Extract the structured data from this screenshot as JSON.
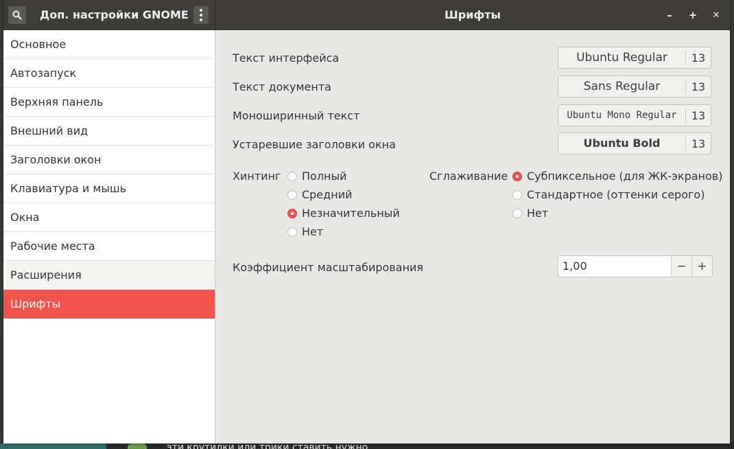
{
  "titlebar": {
    "app_title": "Доп. настройки GNOME",
    "page_title": "Шрифты",
    "minimize_glyph": "–",
    "maximize_glyph": "+",
    "close_glyph": "✕"
  },
  "sidebar": {
    "items": [
      {
        "label": "Основное"
      },
      {
        "label": "Автозапуск"
      },
      {
        "label": "Верхняя панель"
      },
      {
        "label": "Внешний вид"
      },
      {
        "label": "Заголовки окон"
      },
      {
        "label": "Клавиатура и мышь"
      },
      {
        "label": "Окна"
      },
      {
        "label": "Рабочие места"
      },
      {
        "label": "Расширения"
      },
      {
        "label": "Шрифты"
      }
    ],
    "selected": "Шрифты"
  },
  "fonts": {
    "interface": {
      "label": "Текст интерфейса",
      "font": "Ubuntu Regular",
      "size": "13"
    },
    "document": {
      "label": "Текст документа",
      "font": "Sans Regular",
      "size": "13"
    },
    "monospace": {
      "label": "Моноширинный текст",
      "font": "Ubuntu Mono Regular",
      "size": "13"
    },
    "legacy_titles": {
      "label": "Устаревшие заголовки окна",
      "font": "Ubuntu Bold",
      "size": "13"
    }
  },
  "hinting": {
    "label": "Хинтинг",
    "options": [
      "Полный",
      "Средний",
      "Незначительный",
      "Нет"
    ],
    "selected": "Незначительный"
  },
  "antialiasing": {
    "label": "Сглаживание",
    "options": [
      "Субпиксельное (для ЖК-экранов)",
      "Стандартное (оттенки серого)",
      "Нет"
    ],
    "selected": "Субпиксельное (для ЖК-экранов)"
  },
  "scaling": {
    "label": "Коэффициент масштабирования",
    "value": "1,00",
    "minus_glyph": "−",
    "plus_glyph": "+"
  },
  "desktop": {
    "background_text": "эти крутилки или трики ставить нужно"
  },
  "colors": {
    "accent": "#f0544c",
    "titlebar": "#3d3c38",
    "content_bg": "#e8e8e7"
  }
}
